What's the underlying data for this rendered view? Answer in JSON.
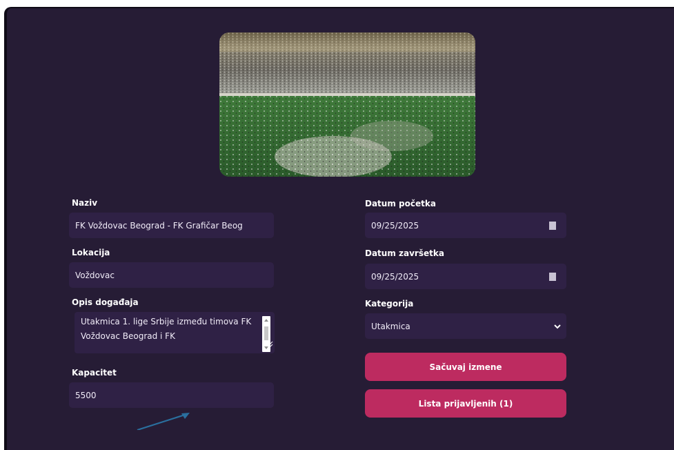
{
  "form": {
    "naziv_label": "Naziv",
    "naziv_value": "FK Voždovac Beograd - FK Grafičar Beog",
    "lokacija_label": "Lokacija",
    "lokacija_value": "Voždovac",
    "opis_label": "Opis događaja",
    "opis_value": "Utakmica 1. lige Srbije između timova FK Voždovac Beograd i FK",
    "kapacitet_label": "Kapacitet",
    "kapacitet_value": "5500",
    "datum_pocetka_label": "Datum početka",
    "datum_pocetka_value": "09/25/2025",
    "datum_zavrsetka_label": "Datum završetka",
    "datum_zavrsetka_value": "09/25/2025",
    "kategorija_label": "Kategorija",
    "kategorija_value": "Utakmica"
  },
  "buttons": {
    "save_label": "Sačuvaj izmene",
    "list_label": "Lista prijavljenih (1)"
  },
  "colors": {
    "panel_bg": "#261c35",
    "field_bg": "#2f2145",
    "accent": "#bd2b60",
    "annotation_arrow": "#2a6f9e"
  },
  "icons": {
    "date_picker": "calendar-icon",
    "select": "chevron-down-icon",
    "annotation": "arrow-icon"
  }
}
